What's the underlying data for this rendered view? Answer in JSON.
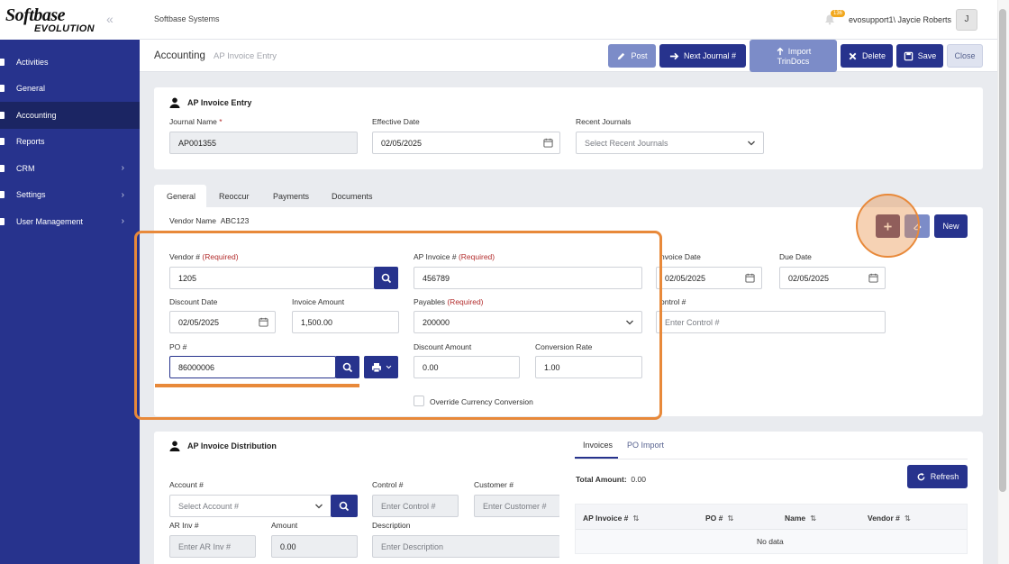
{
  "sidebar": {
    "logo_main": "Softbase",
    "logo_sub": "EVOLUTION",
    "items": [
      {
        "label": "Activities"
      },
      {
        "label": "General"
      },
      {
        "label": "Accounting"
      },
      {
        "label": "Reports"
      },
      {
        "label": "CRM"
      },
      {
        "label": "Settings"
      },
      {
        "label": "User Management"
      }
    ]
  },
  "topbar": {
    "company": "Softbase Systems",
    "notification_count": "136",
    "user": "evosupport1\\ Jaycie Roberts",
    "avatar_initial": "J"
  },
  "subheader": {
    "title": "Accounting",
    "subtitle": "AP Invoice Entry",
    "buttons": {
      "post": "Post",
      "next_journal": "Next Journal #",
      "import_line1": "Import",
      "import_line2": "TrinDocs",
      "delete": "Delete",
      "save": "Save",
      "close": "Close"
    }
  },
  "entry": {
    "title": "AP Invoice Entry",
    "journal_name_label": "Journal Name",
    "journal_name_required": "*",
    "journal_name_value": "AP001355",
    "effective_date_label": "Effective Date",
    "effective_date_value": "02/05/2025",
    "recent_journals_label": "Recent Journals",
    "recent_journals_placeholder": "Select Recent Journals"
  },
  "tabs": [
    "General",
    "Reoccur",
    "Payments",
    "Documents"
  ],
  "general": {
    "vendor_name_label": "Vendor Name",
    "vendor_name_value": "ABC123",
    "new_button": "New",
    "vendor_no_label": "Vendor #",
    "required_text": "(Required)",
    "vendor_no_value": "1205",
    "ap_invoice_label": "AP Invoice #",
    "ap_invoice_value": "456789",
    "invoice_date_label": "nvoice Date",
    "invoice_date_value": "02/05/2025",
    "due_date_label": "Due Date",
    "due_date_value": "02/05/2025",
    "discount_date_label": "Discount Date",
    "discount_date_value": "02/05/2025",
    "invoice_amount_label": "Invoice Amount",
    "invoice_amount_value": "1,500.00",
    "payables_label": "Payables",
    "payables_value": "200000",
    "control_label": "ontrol #",
    "control_placeholder": "Enter Control #",
    "po_label": "PO #",
    "po_value": "86000006",
    "discount_amount_label": "Discount Amount",
    "discount_amount_value": "0.00",
    "conversion_rate_label": "Conversion Rate",
    "conversion_rate_value": "1.00",
    "override_label": "Override Currency Conversion"
  },
  "distribution": {
    "title": "AP Invoice Distribution",
    "account_label": "Account #",
    "account_placeholder": "Select Account #",
    "control_label": "Control #",
    "control_placeholder": "Enter Control #",
    "customer_label": "Customer #",
    "customer_placeholder": "Enter Customer #",
    "ar_inv_label": "AR Inv #",
    "ar_inv_placeholder": "Enter AR Inv #",
    "amount_label": "Amount",
    "amount_value": "0.00",
    "description_label": "Description",
    "description_placeholder": "Enter Description"
  },
  "invoices_panel": {
    "tabs": [
      "Invoices",
      "PO Import"
    ],
    "total_label": "Total Amount:",
    "total_value": "0.00",
    "refresh": "Refresh",
    "columns": [
      "AP Invoice #",
      "PO #",
      "Name",
      "Vendor #"
    ],
    "sort_glyph": "⇅",
    "empty": "No data"
  },
  "colors": {
    "brand": "#27338d",
    "highlight": "#e8893a",
    "required": "#b32d2d"
  }
}
